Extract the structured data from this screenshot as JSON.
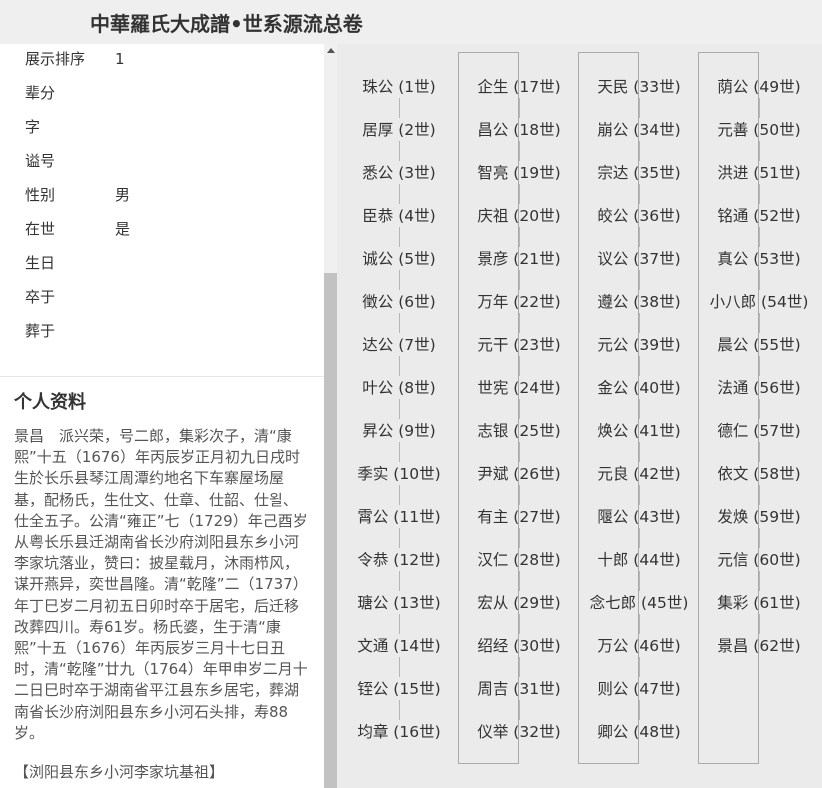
{
  "header": {
    "title": "中華羅氏大成譜•世系源流总卷"
  },
  "fields": [
    {
      "label": "展示排序",
      "value": "1"
    },
    {
      "label": "辈分",
      "value": ""
    },
    {
      "label": "字",
      "value": ""
    },
    {
      "label": "谥号",
      "value": ""
    },
    {
      "label": "性别",
      "value": "男"
    },
    {
      "label": "在世",
      "value": "是"
    },
    {
      "label": "生日",
      "value": ""
    },
    {
      "label": "卒于",
      "value": ""
    },
    {
      "label": "葬于",
      "value": ""
    }
  ],
  "profile": {
    "title": "个人资料",
    "text": "景昌　派兴荣，号二郎，集彩次子，清“康熙”十五（1676）年丙辰岁正月初九日戌时生於长乐县琴江周潭约地名下车寨屋场屋基，配杨氏，生仕文、仕章、仕韶、仕욀、仕全五子。公清“雍正”七（1729）年己酉岁从粤长乐县迁湖南省长沙府浏阳县东乡小河李家坑落业，赞曰：披星载月，沐雨栉风，谋开燕异，奕世昌隆。清“乾隆”二（1737）年丁巳岁二月初五日卯时卒于居宅，后迁移改葬四川。寿61岁。杨氏婆，生于清“康熙”十五（1676）年丙辰岁三月十七日丑时，清“乾隆”廿九（1764）年甲申岁二月十二日巳时卒于湖南省平江县东乡居宅，葬湖南省长沙府浏阳县东乡小河石头排，寿88岁。",
    "note": "【浏阳县东乡小河李家坑基祖】"
  },
  "generations": [
    [
      "珠公 (1世)",
      "居厚 (2世)",
      "悉公 (3世)",
      "臣恭 (4世)",
      "诚公 (5世)",
      "徵公 (6世)",
      "达公 (7世)",
      "叶公 (8世)",
      "昇公 (9世)",
      "季实 (10世)",
      "霄公 (11世)",
      "令恭 (12世)",
      "瑭公 (13世)",
      "文通 (14世)",
      "铚公 (15世)",
      "均章 (16世)"
    ],
    [
      "企生 (17世)",
      "昌公 (18世)",
      "智亮 (19世)",
      "庆祖 (20世)",
      "景彦 (21世)",
      "万年 (22世)",
      "元干 (23世)",
      "世宪 (24世)",
      "志银 (25世)",
      "尹斌 (26世)",
      "有主 (27世)",
      "汉仁 (28世)",
      "宏从 (29世)",
      "绍经 (30世)",
      "周吉 (31世)",
      "仪举 (32世)"
    ],
    [
      "天民 (33世)",
      "崩公 (34世)",
      "宗达 (35世)",
      "皎公 (36世)",
      "议公 (37世)",
      "遵公 (38世)",
      "元公 (39世)",
      "金公 (40世)",
      "焕公 (41世)",
      "元良 (42世)",
      "隁公 (43世)",
      "十郎 (44世)",
      "念七郎 (45世)",
      "万公 (46世)",
      "则公 (47世)",
      "卿公 (48世)"
    ],
    [
      "荫公 (49世)",
      "元善 (50世)",
      "洪进 (51世)",
      "铭通 (52世)",
      "真公 (53世)",
      "小八郎 (54世)",
      "晨公 (55世)",
      "法通 (56世)",
      "德仁 (57世)",
      "依文 (58世)",
      "发焕 (59世)",
      "元信 (60世)",
      "集彩 (61世)",
      "景昌 (62世)"
    ]
  ]
}
